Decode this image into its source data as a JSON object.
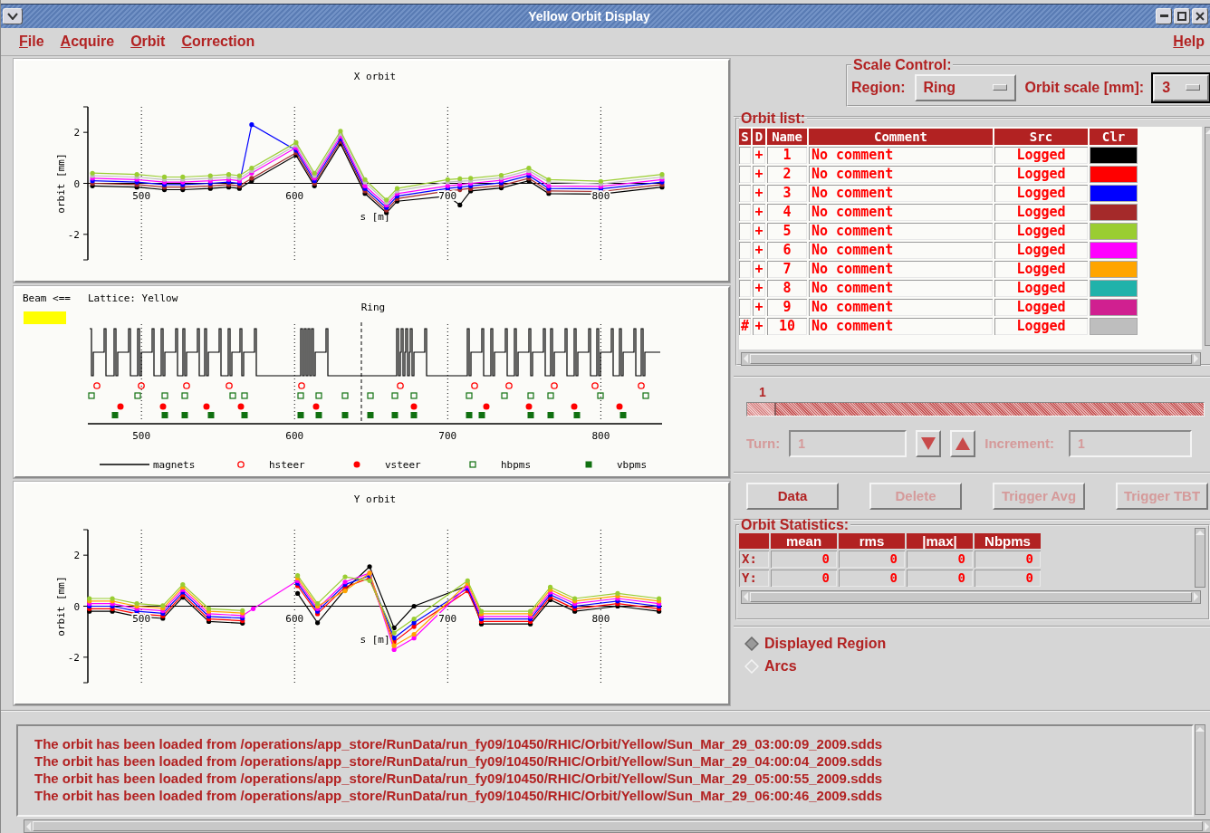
{
  "window": {
    "title": "Yellow Orbit Display"
  },
  "menu": [
    {
      "label": "File"
    },
    {
      "label": "Acquire"
    },
    {
      "label": "Orbit"
    },
    {
      "label": "Correction"
    }
  ],
  "help_menu": {
    "label": "Help"
  },
  "x_orbit": {
    "chart_data": {
      "type": "line",
      "title": "X orbit",
      "xlabel": "s [m]",
      "ylabel": "orbit [mm]",
      "xlim": [
        465,
        840
      ],
      "ylim": [
        -3,
        3
      ],
      "xticks": [
        500,
        600,
        700,
        800
      ],
      "yticks": [
        -2,
        0,
        2
      ],
      "grid": true,
      "x": [
        468,
        497,
        515,
        527,
        545,
        557,
        564,
        572,
        601,
        613,
        630,
        646,
        660,
        667,
        700,
        708,
        715,
        735,
        753,
        766,
        800,
        840
      ],
      "series": [
        {
          "color": "#000000",
          "marker": true,
          "values": [
            -0.1,
            -0.15,
            -0.25,
            -0.25,
            -0.2,
            -0.15,
            -0.2,
            0.1,
            1.1,
            -0.1,
            1.55,
            -0.4,
            -1.15,
            -0.7,
            -0.5,
            -0.85,
            -0.3,
            -0.18,
            0.1,
            -0.4,
            -0.42,
            -0.15
          ]
        },
        {
          "color": "#a52a2a",
          "marker": true,
          "values": [
            0,
            -0.05,
            -0.15,
            -0.15,
            -0.1,
            -0.05,
            -0.1,
            0.2,
            1.2,
            0,
            1.65,
            -0.3,
            -1.05,
            -0.6,
            -0.3,
            -0.25,
            -0.2,
            -0.08,
            0.2,
            -0.3,
            -0.32,
            -0.05
          ]
        },
        {
          "color": "#0000ff",
          "marker": true,
          "values": [
            0.1,
            0.05,
            -0.05,
            -0.05,
            0,
            0.05,
            0,
            2.3,
            1.3,
            0.1,
            1.75,
            -0.2,
            -0.95,
            -0.5,
            -0.2,
            -0.15,
            -0.1,
            0.02,
            0.3,
            -0.2,
            -0.22,
            0.05
          ]
        },
        {
          "color": "#ff00ff",
          "marker": true,
          "values": [
            0.2,
            0.15,
            0.05,
            0.05,
            0.1,
            0.15,
            0.1,
            0.4,
            1.4,
            0.2,
            1.85,
            -0.1,
            -0.85,
            -0.4,
            -0.1,
            -0.05,
            0,
            0.12,
            0.4,
            -0.1,
            -0.12,
            0.15
          ]
        },
        {
          "color": "#bebebe",
          "marker": true,
          "values": [
            0.3,
            0.25,
            0.15,
            0.15,
            0.2,
            0.25,
            0.2,
            0.5,
            1.5,
            0.3,
            1.95,
            0.05,
            -0.75,
            -0.3,
            0.05,
            0.08,
            0.1,
            0.22,
            0.5,
            0.05,
            -0.02,
            0.25
          ]
        },
        {
          "color": "#9acd32",
          "marker": true,
          "values": [
            0.4,
            0.35,
            0.25,
            0.25,
            0.3,
            0.35,
            0.3,
            0.6,
            1.6,
            0.4,
            2.05,
            0.15,
            -0.65,
            -0.2,
            0.15,
            0.18,
            0.2,
            0.32,
            0.6,
            0.15,
            0.08,
            0.35
          ]
        }
      ]
    }
  },
  "lattice": {
    "beam_label": "Beam <==",
    "lattice_label": "Lattice: Yellow",
    "title": "Ring",
    "xticks": [
      "500",
      "600",
      "700",
      "800"
    ],
    "legend": [
      {
        "kind": "line",
        "label": "magnets"
      },
      {
        "kind": "open_circle",
        "label": "hsteer"
      },
      {
        "kind": "dot",
        "label": "vsteer"
      },
      {
        "kind": "open_square",
        "label": "hbpms"
      },
      {
        "kind": "square",
        "label": "vbpms"
      }
    ]
  },
  "y_orbit": {
    "chart_data": {
      "type": "line",
      "title": "Y orbit",
      "xlabel": "s [m]",
      "ylabel": "orbit [mm]",
      "xlim": [
        465,
        840
      ],
      "ylim": [
        -3,
        3
      ],
      "xticks": [
        500,
        600,
        700,
        800
      ],
      "yticks": [
        -2,
        0,
        2
      ],
      "grid": true,
      "x": [
        466,
        481,
        497,
        514,
        527,
        544,
        566,
        573,
        602,
        615,
        633,
        649,
        665,
        678,
        713,
        722,
        754,
        767,
        783,
        811,
        838
      ],
      "series": [
        {
          "color": "#000000",
          "marker": true,
          "values": [
            -0.2,
            -0.2,
            -0.4,
            -0.48,
            0.35,
            -0.6,
            -0.67,
            null,
            0.5,
            -0.65,
            0.65,
            1.55,
            -0.85,
            0,
            0.8,
            -0.7,
            -0.7,
            0.25,
            -0.2,
            0,
            -0.2
          ]
        },
        {
          "color": "#ff0000",
          "marker": true,
          "values": [
            -0.1,
            -0.1,
            -0.3,
            -0.38,
            0.45,
            -0.5,
            -0.57,
            null,
            0.8,
            -0.3,
            0.75,
            1.1,
            -1.4,
            -0.8,
            0.6,
            -0.6,
            -0.6,
            0.35,
            -0.1,
            0.1,
            -0.1
          ]
        },
        {
          "color": "#0000ff",
          "marker": true,
          "values": [
            0,
            0,
            -0.2,
            -0.28,
            0.55,
            -0.4,
            -0.47,
            null,
            0.9,
            -0.2,
            0.85,
            1.2,
            -1.25,
            -0.65,
            0.7,
            -0.5,
            -0.5,
            0.45,
            0,
            0.2,
            0
          ]
        },
        {
          "color": "#ff00ff",
          "marker": true,
          "values": [
            0.1,
            0.1,
            -0.1,
            -0.18,
            0.65,
            -0.3,
            -0.37,
            -0.1,
            1.0,
            -0.1,
            0.95,
            1.3,
            -1.7,
            -1.25,
            0.8,
            -0.4,
            -0.4,
            0.55,
            0.1,
            0.3,
            0.1
          ]
        },
        {
          "color": "#ffa500",
          "marker": true,
          "values": [
            0.2,
            0.2,
            0,
            -0.08,
            0.75,
            -0.2,
            -0.27,
            null,
            1.1,
            0,
            0.6,
            1.3,
            -1.55,
            -1.1,
            0.9,
            -0.3,
            -0.3,
            0.65,
            0.2,
            0.4,
            0.2
          ]
        },
        {
          "color": "#9acd32",
          "marker": true,
          "values": [
            0.3,
            0.3,
            0.1,
            0.02,
            0.85,
            -0.1,
            -0.17,
            null,
            1.2,
            0.1,
            1.15,
            1.0,
            -1.05,
            -0.5,
            1.0,
            -0.2,
            -0.2,
            0.75,
            0.3,
            0.5,
            0.3
          ]
        }
      ]
    }
  },
  "scale_control": {
    "title": "Scale Control:",
    "region_label": "Region:",
    "region": "Ring",
    "orbit_scale_label": "Orbit scale [mm]:",
    "orbit_scale": "3"
  },
  "orbit_list": {
    "title": "Orbit list:",
    "columns": [
      "S",
      "D",
      "Name",
      "Comment",
      "Src",
      "Clr"
    ],
    "rows": [
      {
        "d": "+",
        "name": "1",
        "comment": "No comment",
        "src": "Logged",
        "color": "#000000"
      },
      {
        "d": "+",
        "name": "2",
        "comment": "No comment",
        "src": "Logged",
        "color": "#ff0000"
      },
      {
        "d": "+",
        "name": "3",
        "comment": "No comment",
        "src": "Logged",
        "color": "#0000ff"
      },
      {
        "d": "+",
        "name": "4",
        "comment": "No comment",
        "src": "Logged",
        "color": "#a52a2a"
      },
      {
        "d": "+",
        "name": "5",
        "comment": "No comment",
        "src": "Logged",
        "color": "#9acd32"
      },
      {
        "d": "+",
        "name": "6",
        "comment": "No comment",
        "src": "Logged",
        "color": "#ff00ff"
      },
      {
        "d": "+",
        "name": "7",
        "comment": "No comment",
        "src": "Logged",
        "color": "#ffa500"
      },
      {
        "d": "+",
        "name": "8",
        "comment": "No comment",
        "src": "Logged",
        "color": "#20b2aa"
      },
      {
        "d": "+",
        "name": "9",
        "comment": "No comment",
        "src": "Logged",
        "color": "#d02090"
      },
      {
        "s": "#",
        "d": "+",
        "name": "10",
        "comment": "No comment",
        "src": "Logged",
        "color": "#bebebe"
      }
    ]
  },
  "turn_slider": {
    "value": "1",
    "level": 0
  },
  "turn": {
    "label": "Turn:",
    "value": "1",
    "disabled": true
  },
  "increment": {
    "label": "Increment:",
    "value": "1",
    "disabled": true
  },
  "buttons": [
    {
      "label": "Data",
      "disabled": false
    },
    {
      "label": "Delete",
      "disabled": true
    },
    {
      "label": "Trigger Avg",
      "disabled": true
    },
    {
      "label": "Trigger TBT",
      "disabled": true
    }
  ],
  "orbit_statistics": {
    "title": "Orbit Statistics:",
    "columns": [
      "mean",
      "rms",
      "|max|",
      "Nbpms"
    ],
    "rows": [
      {
        "label": "X:",
        "values": [
          "0",
          "0",
          "0",
          "0"
        ]
      },
      {
        "label": "Y:",
        "values": [
          "0",
          "0",
          "0",
          "0"
        ]
      }
    ]
  },
  "region_options": [
    {
      "label": "Displayed Region",
      "selected": true
    },
    {
      "label": "Arcs",
      "selected": false
    }
  ],
  "log": [
    "The orbit has been  loaded from /operations/app_store/RunData/run_fy09/10450/RHIC/Orbit/Yellow/Sun_Mar_29_03:00:09_2009.sdds",
    "The orbit has been  loaded from /operations/app_store/RunData/run_fy09/10450/RHIC/Orbit/Yellow/Sun_Mar_29_04:00:04_2009.sdds",
    "The orbit has been  loaded from /operations/app_store/RunData/run_fy09/10450/RHIC/Orbit/Yellow/Sun_Mar_29_05:00:55_2009.sdds",
    "The orbit has been  loaded from /operations/app_store/RunData/run_fy09/10450/RHIC/Orbit/Yellow/Sun_Mar_29_06:00:46_2009.sdds"
  ]
}
